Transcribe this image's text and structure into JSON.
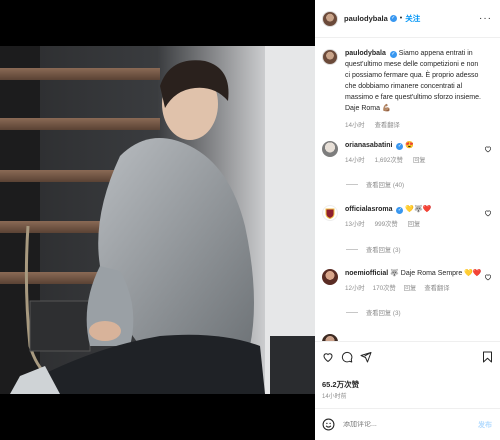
{
  "header": {
    "username": "paulodybala",
    "dot": "•",
    "follow_label": "关注",
    "more": "···"
  },
  "caption": {
    "username": "paulodybala",
    "text": "Siamo appena entrati in quest'ultimo mese delle competizioni e non ci possiamo fermare qua. È proprio adesso che dobbiamo rimanere concentrati al massimo e fare quest'ultimo sforzo insieme. Daje Roma 💪🏽",
    "time": "14小时",
    "translate": "查看翻译"
  },
  "comments": [
    {
      "username": "orianasabatini",
      "text": "😍",
      "time": "14小时",
      "likes": "1,692次赞",
      "reply": "回复",
      "replies": "查看回复 (40)"
    },
    {
      "username": "officialasroma",
      "text": "💛🐺❤️",
      "time": "13小时",
      "likes": "999次赞",
      "reply": "回复",
      "replies": "查看回复 (3)"
    },
    {
      "username": "noemiofficial",
      "text": "🐺 Daje Roma Sempre 💛❤️",
      "time": "12小时",
      "likes": "170次赞",
      "reply": "回复",
      "translate": "查看翻译",
      "replies": "查看回复 (3)"
    }
  ],
  "likes_count": "65.2万次赞",
  "posted_ago": "14小时前",
  "add_comment": {
    "placeholder": "添加评论...",
    "post_label": "发布"
  },
  "colors": {
    "accent": "#0095f6",
    "verified": "#3897f0"
  },
  "icons": [
    "verified-badge-icon",
    "more-options-icon",
    "heart-icon",
    "comment-icon",
    "share-icon",
    "save-icon",
    "emoji-icon"
  ]
}
